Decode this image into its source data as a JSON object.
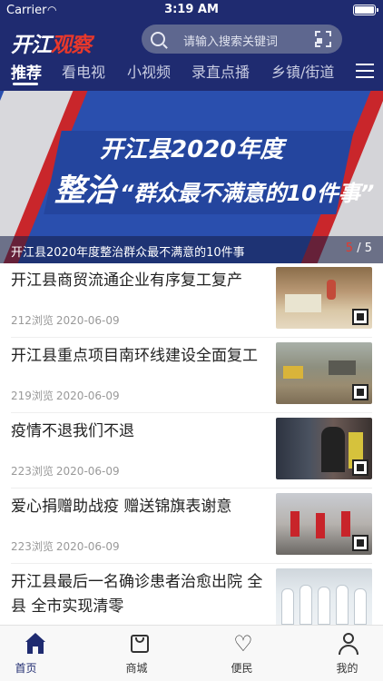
{
  "status_bar": {
    "carrier": "Carrier",
    "time": "3:19 AM"
  },
  "header": {
    "logo_main": "开江",
    "logo_accent": "观察",
    "search_placeholder": "请输入搜索关键词"
  },
  "tabs": [
    {
      "label": "推荐",
      "active": true
    },
    {
      "label": "看电视",
      "active": false
    },
    {
      "label": "小视频",
      "active": false
    },
    {
      "label": "录直点播",
      "active": false
    },
    {
      "label": "乡镇/街道",
      "active": false
    }
  ],
  "banner": {
    "headline_line1": "开江县2020年度",
    "headline_line2_big": "整治",
    "headline_line2_rest": "“群众最不满意的10件事”",
    "caption": "开江县2020年度整治群众最不满意的10件事",
    "pager_current": "5",
    "pager_sep": "/",
    "pager_total": "5"
  },
  "news": [
    {
      "title": "开江县商贸流通企业有序复工复产",
      "views": "212浏览",
      "date": "2020-06-09",
      "thumb": "market"
    },
    {
      "title": "开江县重点项目南环线建设全面复工",
      "views": "219浏览",
      "date": "2020-06-09",
      "thumb": "construction"
    },
    {
      "title": "疫情不退我们不退",
      "views": "223浏览",
      "date": "2020-06-09",
      "thumb": "checkpoint"
    },
    {
      "title": "爱心捐赠助战疫 赠送锦旗表谢意",
      "views": "223浏览",
      "date": "2020-06-09",
      "thumb": "banner-gift"
    },
    {
      "title": "开江县最后一名确诊患者治愈出院 全县 全市实现清零",
      "views": "",
      "date": "",
      "thumb": "doctors"
    }
  ],
  "bottom_nav": [
    {
      "label": "首页",
      "icon": "home-icon",
      "active": true
    },
    {
      "label": "商城",
      "icon": "shopping-bag-icon",
      "active": false
    },
    {
      "label": "便民",
      "icon": "heart-icon",
      "active": false
    },
    {
      "label": "我的",
      "icon": "user-icon",
      "active": false
    }
  ],
  "colors": {
    "header_bg": "#1f2b70",
    "accent_red": "#e8382b",
    "banner_blue": "#2a4fae",
    "meta_gray": "#999999"
  }
}
